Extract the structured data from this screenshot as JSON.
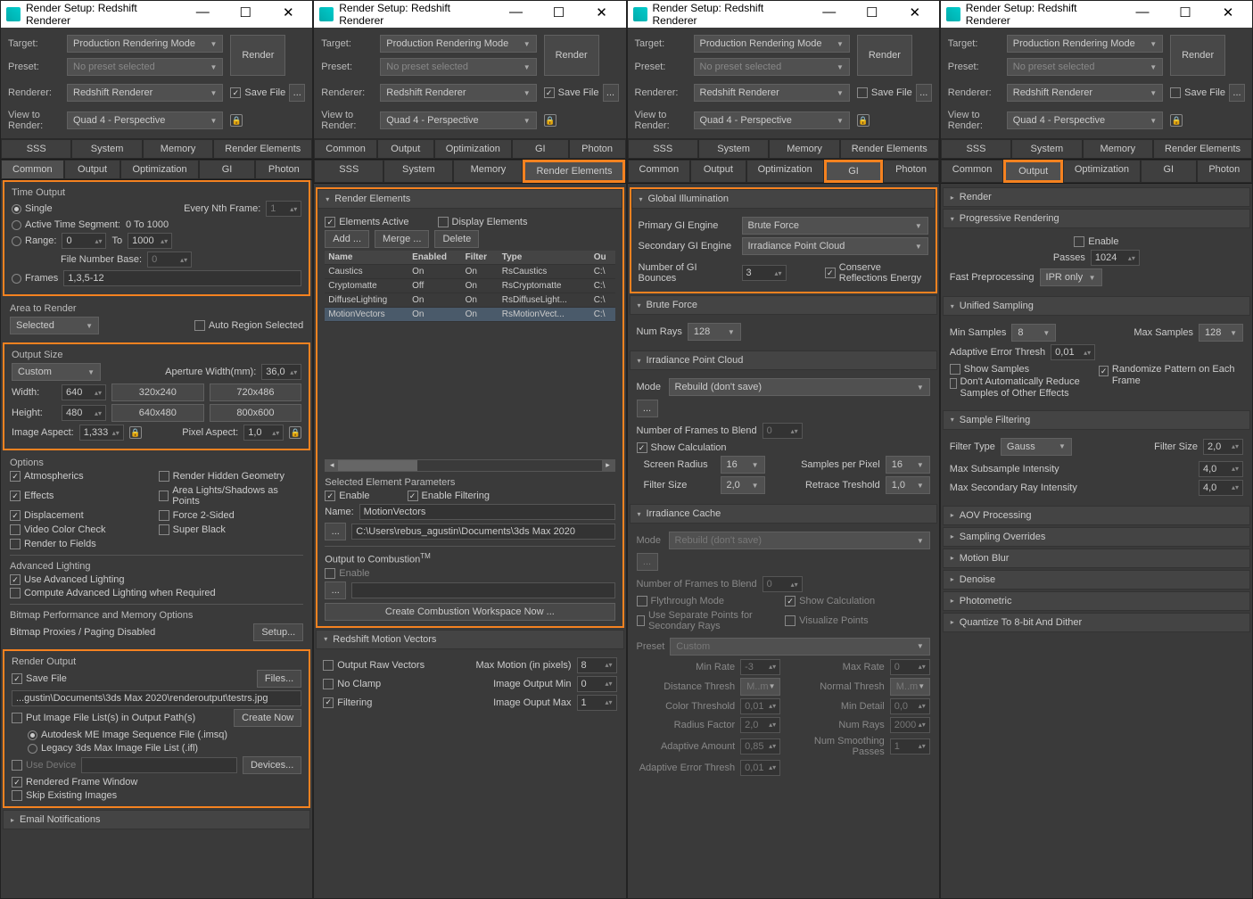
{
  "title": "Render Setup: Redshift Renderer",
  "hdr": {
    "target": "Target:",
    "targetv": "Production Rendering Mode",
    "preset": "Preset:",
    "presetv": "No preset selected",
    "renderer": "Renderer:",
    "rendererv": "Redshift Renderer",
    "savefile": "Save File",
    "dots": "...",
    "view": "View to Render:",
    "viewv": "Quad 4 - Perspective",
    "render": "Render"
  },
  "tabs": {
    "sss": "SSS",
    "system": "System",
    "memory": "Memory",
    "re": "Render Elements",
    "common": "Common",
    "output": "Output",
    "opt": "Optimization",
    "gi": "GI",
    "photon": "Photon"
  },
  "p1": {
    "to": {
      "h": "Time Output",
      "single": "Single",
      "enf": "Every Nth Frame:",
      "enfv": "1",
      "ats": "Active Time Segment:",
      "atsv": "0 To 1000",
      "range": "Range:",
      "r0": "0",
      "to_": "To",
      "r1": "1000",
      "fnb": "File Number Base:",
      "fnbv": "0",
      "frames": "Frames",
      "framesv": "1,3,5-12"
    },
    "ar": {
      "h": "Area to Render",
      "sel": "Selected",
      "auto": "Auto Region Selected"
    },
    "os": {
      "h": "Output Size",
      "custom": "Custom",
      "aw": "Aperture Width(mm):",
      "awv": "36,0",
      "w": "Width:",
      "wv": "640",
      "h_": "Height:",
      "hv": "480",
      "p1": "320x240",
      "p2": "720x486",
      "p3": "640x480",
      "p4": "800x600",
      "ia": "Image Aspect:",
      "iav": "1,333",
      "pa": "Pixel Aspect:",
      "pav": "1,0"
    },
    "opt": {
      "h": "Options",
      "atm": "Atmospherics",
      "rhg": "Render Hidden Geometry",
      "eff": "Effects",
      "als": "Area Lights/Shadows as Points",
      "disp": "Displacement",
      "f2s": "Force 2-Sided",
      "vcc": "Video Color Check",
      "sb": "Super Black",
      "rtf": "Render to Fields"
    },
    "al": {
      "h": "Advanced Lighting",
      "ual": "Use Advanced Lighting",
      "calr": "Compute Advanced Lighting when Required"
    },
    "bm": {
      "h": "Bitmap Performance and Memory Options",
      "bp": "Bitmap Proxies / Paging Disabled",
      "setup": "Setup..."
    },
    "ro": {
      "h": "Render Output",
      "sf": "Save File",
      "files": "Files...",
      "path": "...gustin\\Documents\\3ds Max 2020\\renderoutput\\testrs.jpg",
      "pifl": "Put Image File List(s) in Output Path(s)",
      "cn": "Create Now",
      "ame": "Autodesk ME Image Sequence File (.imsq)",
      "leg": "Legacy 3ds Max Image File List (.ifl)",
      "ud": "Use Device",
      "dev": "Devices...",
      "rfw": "Rendered Frame Window",
      "sei": "Skip Existing Images"
    },
    "en": "Email Notifications"
  },
  "p2": {
    "re": {
      "h": "Render Elements",
      "ea": "Elements Active",
      "de": "Display Elements",
      "add": "Add ...",
      "merge": "Merge ...",
      "del": "Delete"
    },
    "th": {
      "name": "Name",
      "en": "Enabled",
      "fil": "Filter",
      "type": "Type",
      "out": "Ou"
    },
    "rows": [
      {
        "n": "Caustics",
        "e": "On",
        "f": "On",
        "t": "RsCaustics",
        "o": "C:\\"
      },
      {
        "n": "Cryptomatte",
        "e": "Off",
        "f": "On",
        "t": "RsCryptomatte",
        "o": "C:\\"
      },
      {
        "n": "DiffuseLighting",
        "e": "On",
        "f": "On",
        "t": "RsDiffuseLight...",
        "o": "C:\\"
      },
      {
        "n": "MotionVectors",
        "e": "On",
        "f": "On",
        "t": "RsMotionVect...",
        "o": "C:\\"
      }
    ],
    "sep": {
      "h": "Selected Element Parameters",
      "en": "Enable",
      "ef": "Enable Filtering",
      "name": "Name:",
      "namev": "MotionVectors",
      "dots": "...",
      "path": "C:\\Users\\rebus_agustin\\Documents\\3ds Max 2020"
    },
    "oc": {
      "h": "Output to Combustion",
      "tm": "TM",
      "en": "Enable",
      "dots": "...",
      "btn": "Create Combustion Workspace Now ..."
    },
    "rmv": {
      "h": "Redshift Motion Vectors",
      "orv": "Output Raw Vectors",
      "nc": "No Clamp",
      "fil": "Filtering",
      "mm": "Max Motion (in pixels)",
      "mmv": "8",
      "iomin": "Image Output Min",
      "iominv": "0",
      "iomax": "Image Ouput Max",
      "iomaxv": "1"
    }
  },
  "p3": {
    "gi": {
      "h": "Global Illumination",
      "pge": "Primary GI Engine",
      "pgev": "Brute Force",
      "sge": "Secondary GI Engine",
      "sgev": "Irradiance Point Cloud",
      "ngb": "Number of GI Bounces",
      "ngbv": "3",
      "cre": "Conserve Reflections Energy"
    },
    "bf": {
      "h": "Brute Force",
      "nr": "Num Rays",
      "nrv": "128"
    },
    "ipc": {
      "h": "Irradiance Point Cloud",
      "mode": "Mode",
      "modev": "Rebuild (don't save)",
      "dots": "...",
      "nfb": "Number of Frames to Blend",
      "nfbv": "0",
      "sc": "Show Calculation",
      "sr": "Screen Radius",
      "srv": "16",
      "spp": "Samples per Pixel",
      "sppv": "16",
      "fs": "Filter Size",
      "fsv": "2,0",
      "rt": "Retrace Treshold",
      "rtv": "1,0"
    },
    "ic": {
      "h": "Irradiance Cache",
      "mode": "Mode",
      "modev": "Rebuild (don't save)",
      "dots": "...",
      "nfb": "Number of Frames to Blend",
      "nfbv": "0",
      "fm": "Flythrough Mode",
      "sc": "Show Calculation",
      "usp": "Use Separate Points for Secondary Rays",
      "vp": "Visualize Points",
      "preset": "Preset",
      "presetv": "Custom",
      "minr": "Min Rate",
      "minrv": "-3",
      "maxr": "Max Rate",
      "maxrv": "0",
      "dt": "Distance Thresh",
      "dtv": "M..m",
      "nt": "Normal Thresh",
      "ntv": "M..m",
      "ct": "Color Threshold",
      "ctv": "0,01",
      "md": "Min Detail",
      "mdv": "0,0",
      "rf": "Radius Factor",
      "rfv": "2,0",
      "nr": "Num Rays",
      "nrv": "2000",
      "aa": "Adaptive Amount",
      "aav": "0,85",
      "nsp": "Num Smoothing Passes",
      "nspv": "1",
      "aet": "Adaptive Error Thresh",
      "aetv": "0,01"
    }
  },
  "p4": {
    "rend": "Render",
    "pr": {
      "h": "Progressive Rendering",
      "en": "Enable",
      "passes": "Passes",
      "passesv": "1024",
      "fp": "Fast Preprocessing",
      "fpv": "IPR only"
    },
    "us": {
      "h": "Unified Sampling",
      "mins": "Min Samples",
      "minsv": "8",
      "maxs": "Max Samples",
      "maxsv": "128",
      "aet": "Adaptive Error Thresh",
      "aetv": "0,01",
      "ss": "Show Samples",
      "dar": "Don't Automatically Reduce Samples of Other Effects",
      "rp": "Randomize Pattern on Each Frame"
    },
    "sf": {
      "h": "Sample Filtering",
      "ft": "Filter Type",
      "ftv": "Gauss",
      "fs": "Filter Size",
      "fsv": "2,0",
      "msi": "Max Subsample Intensity",
      "msiv": "4,0",
      "msri": "Max Secondary Ray Intensity",
      "msriv": "4,0"
    },
    "sections": [
      "AOV Processing",
      "Sampling Overrides",
      "Motion Blur",
      "Denoise",
      "Photometric",
      "Quantize To 8-bit And Dither"
    ]
  }
}
